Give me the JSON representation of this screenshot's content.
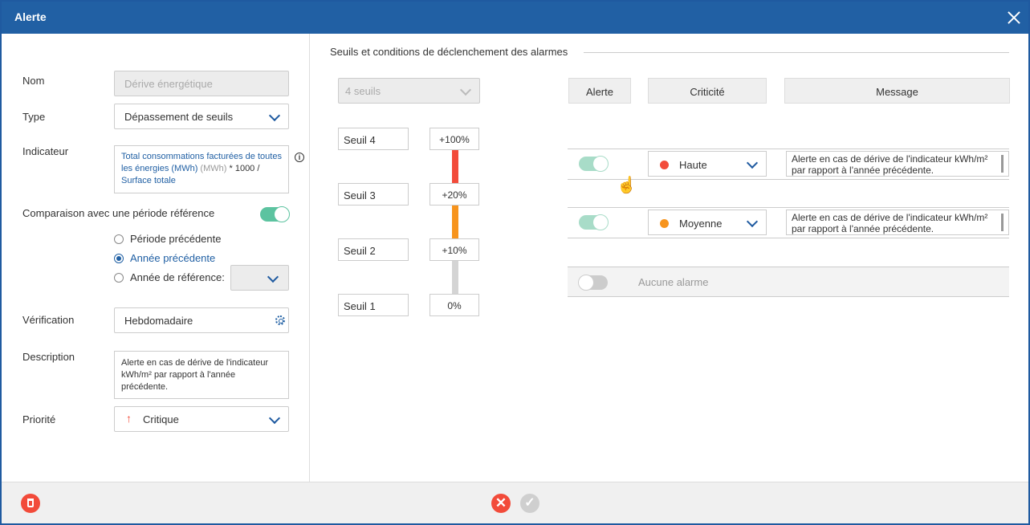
{
  "window": {
    "title": "Alerte"
  },
  "form": {
    "nom_label": "Nom",
    "nom_value": "Dérive énergétique",
    "type_label": "Type",
    "type_value": "Dépassement de seuils",
    "indicateur_label": "Indicateur",
    "indicateur": {
      "part1": "Total consommations facturées de toutes les énergies (MWh)",
      "unit": "(MWh)",
      "op1": "*",
      "num": "1000",
      "op2": "/",
      "part2": "Surface totale"
    },
    "comparaison_label": "Comparaison avec une période référence",
    "comparaison_enabled": true,
    "radios": [
      {
        "label": "Période précédente",
        "selected": false
      },
      {
        "label": "Année précédente",
        "selected": true
      },
      {
        "label": "Année de référence:",
        "selected": false
      }
    ],
    "verification_label": "Vérification",
    "verification_value": "Hebdomadaire",
    "description_label": "Description",
    "description_value": "Alerte en cas de dérive de l'indicateur kWh/m² par rapport à l'année précédente.",
    "priorite_label": "Priorité",
    "priorite_value": "Critique"
  },
  "thresholds": {
    "section_title": "Seuils et conditions de déclenchement des alarmes",
    "count_select": "4 seuils",
    "seuils": [
      {
        "name": "Seuil 4",
        "value": "+100%"
      },
      {
        "name": "Seuil 3",
        "value": "+20%"
      },
      {
        "name": "Seuil 2",
        "value": "+10%"
      },
      {
        "name": "Seuil 1",
        "value": "0%"
      }
    ],
    "bar_colors": [
      "#f24b3a",
      "#f7941d",
      "#d4d4d4"
    ]
  },
  "alarms": {
    "headers": {
      "alerte": "Alerte",
      "criticite": "Criticité",
      "message": "Message"
    },
    "rows": [
      {
        "enabled": true,
        "criticite": "Haute",
        "color": "#f24b3a",
        "message": "Alerte en cas de dérive de l'indicateur kWh/m² par rapport à l'année précédente."
      },
      {
        "enabled": true,
        "criticite": "Moyenne",
        "color": "#f7941d",
        "message": "Alerte en cas de dérive de l'indicateur kWh/m² par rapport à l'année précédente."
      }
    ],
    "none_label": "Aucune alarme"
  },
  "colors": {
    "header": "#2160a4",
    "danger": "#f24b3a",
    "toggle": "#5cc3a0"
  }
}
